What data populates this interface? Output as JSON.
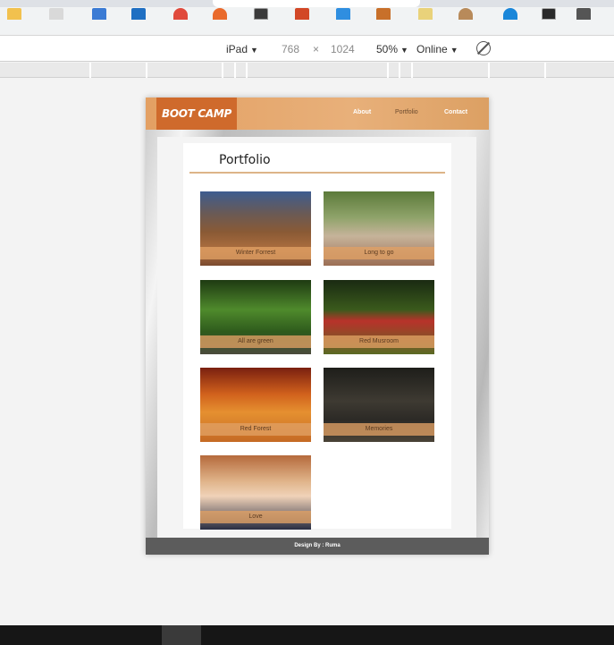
{
  "devtools": {
    "device": "iPad",
    "width": "768",
    "times": "×",
    "height": "1024",
    "zoom": "50%",
    "network": "Online"
  },
  "site": {
    "logo": "BOOT CAMP",
    "nav": [
      {
        "label": "About"
      },
      {
        "label": "Portfolio"
      },
      {
        "label": "Contact"
      }
    ],
    "title": "Portfolio",
    "items": [
      {
        "caption": "Winter Forrest"
      },
      {
        "caption": "Long to go"
      },
      {
        "caption": "All are green"
      },
      {
        "caption": "Red Musroom"
      },
      {
        "caption": "Red Forest"
      },
      {
        "caption": "Memories"
      },
      {
        "caption": "Love"
      }
    ],
    "footer": "Design By : Ruma"
  },
  "taskbar": {
    "icons": [
      "file-explorer-icon",
      "store-icon",
      "visual-studio-icon",
      "mail-icon",
      "chrome-icon",
      "firefox-icon",
      "terminal-icon",
      "powerpoint-icon",
      "vscode-icon",
      "app-icon",
      "notepad-icon",
      "paint-icon",
      "help-icon",
      "people-icon",
      "tray-icon"
    ]
  },
  "colors": {
    "accent": "#e3a063",
    "logo_bg": "#cf6a2c",
    "footer_bg": "#5c5c5c"
  }
}
